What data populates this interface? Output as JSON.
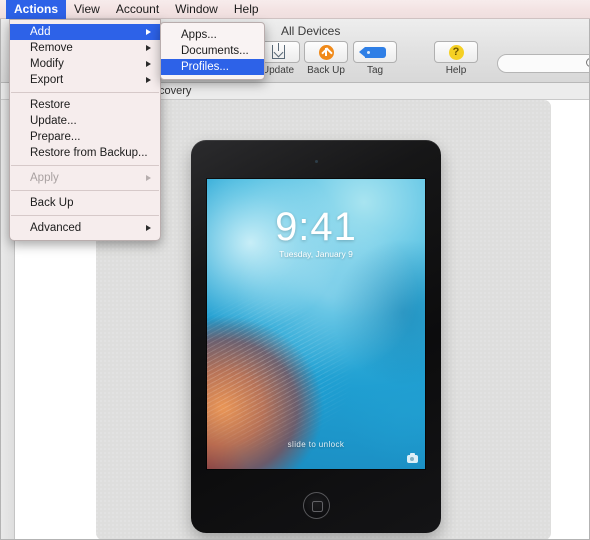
{
  "menubar": {
    "items": [
      {
        "label": "Actions",
        "active": true
      },
      {
        "label": "View",
        "active": false
      },
      {
        "label": "Account",
        "active": false
      },
      {
        "label": "Window",
        "active": false
      },
      {
        "label": "Help",
        "active": false
      }
    ]
  },
  "actions_menu": {
    "groups": [
      [
        {
          "label": "Add",
          "submenu": true,
          "highlighted": true,
          "disabled": false
        },
        {
          "label": "Remove",
          "submenu": true,
          "highlighted": false,
          "disabled": false
        },
        {
          "label": "Modify",
          "submenu": true,
          "highlighted": false,
          "disabled": false
        },
        {
          "label": "Export",
          "submenu": true,
          "highlighted": false,
          "disabled": false
        }
      ],
      [
        {
          "label": "Restore",
          "submenu": false,
          "highlighted": false,
          "disabled": false
        },
        {
          "label": "Update...",
          "submenu": false,
          "highlighted": false,
          "disabled": false
        },
        {
          "label": "Prepare...",
          "submenu": false,
          "highlighted": false,
          "disabled": false
        },
        {
          "label": "Restore from Backup...",
          "submenu": false,
          "highlighted": false,
          "disabled": false
        }
      ],
      [
        {
          "label": "Apply",
          "submenu": true,
          "highlighted": false,
          "disabled": true
        }
      ],
      [
        {
          "label": "Back Up",
          "submenu": false,
          "highlighted": false,
          "disabled": false
        }
      ],
      [
        {
          "label": "Advanced",
          "submenu": true,
          "highlighted": false,
          "disabled": false
        }
      ]
    ]
  },
  "add_submenu": {
    "items": [
      {
        "label": "Apps...",
        "highlighted": false
      },
      {
        "label": "Documents...",
        "highlighted": false
      },
      {
        "label": "Profiles...",
        "highlighted": true
      }
    ]
  },
  "toolbar": {
    "title": "All Devices",
    "buttons": [
      {
        "label": "Update",
        "icon": "update-icon"
      },
      {
        "label": "Back Up",
        "icon": "backup-icon"
      },
      {
        "label": "Tag",
        "icon": "tag-icon"
      },
      {
        "label": "Help",
        "icon": "help-icon"
      }
    ],
    "help_glyph": "?",
    "search_placeholder": ""
  },
  "subbar": {
    "text": "covery"
  },
  "device": {
    "lock_time": "9:41",
    "lock_date": "Tuesday, January 9",
    "slide_text": "slide to unlock",
    "camera_icon": "camera-icon",
    "home_button": "home-button"
  },
  "colors": {
    "menu_highlight": "#2d62e8",
    "menubar_bg": "#f3e3e3",
    "canvas_bg": "#dededd",
    "backup_orange": "#f08a1a",
    "tag_blue": "#2f7fe6",
    "help_yellow": "#f5d024"
  }
}
